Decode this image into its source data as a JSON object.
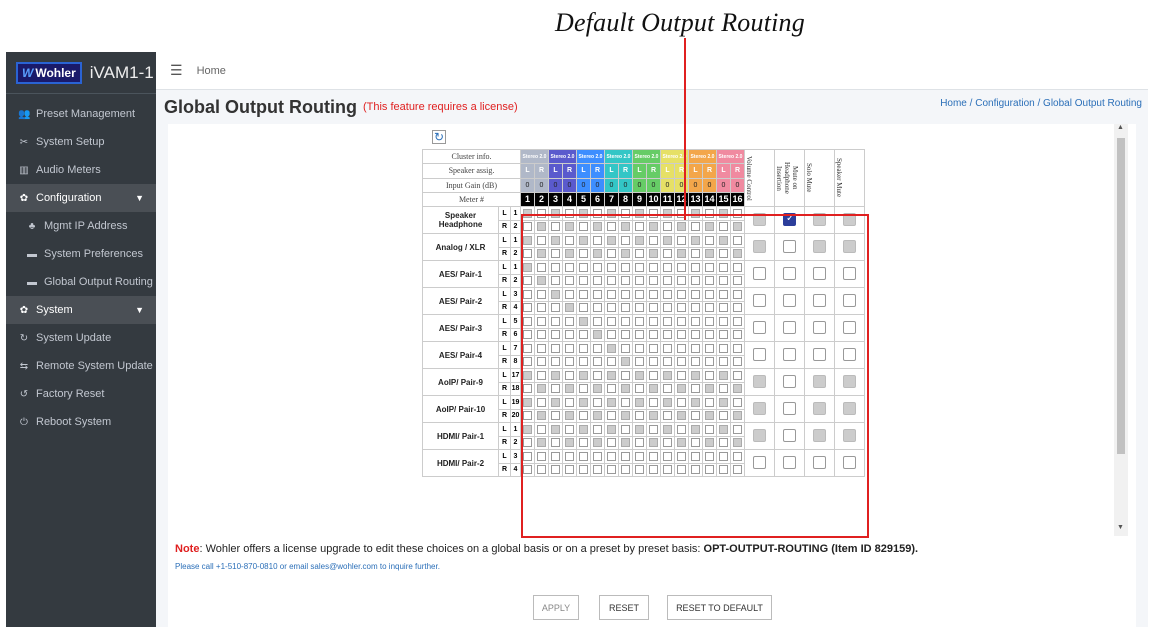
{
  "annotation": {
    "title": "Default Output Routing"
  },
  "sidebar": {
    "logo": "Wohler",
    "app_name": "iVAM1-1",
    "items": [
      {
        "label": "Preset Management",
        "icon": "users-icon"
      },
      {
        "label": "System Setup",
        "icon": "tools-icon"
      },
      {
        "label": "Audio Meters",
        "icon": "chart-icon"
      },
      {
        "label": "Configuration",
        "icon": "gear-icon"
      },
      {
        "label": "Mgmt IP Address",
        "icon": "network-icon"
      },
      {
        "label": "System Preferences",
        "icon": "card-icon"
      },
      {
        "label": "Global Output Routing",
        "icon": "card-icon"
      },
      {
        "label": "System",
        "icon": "gears-icon"
      },
      {
        "label": "System Update",
        "icon": "refresh-icon"
      },
      {
        "label": "Remote System Update",
        "icon": "remote-icon"
      },
      {
        "label": "Factory Reset",
        "icon": "undo-icon"
      },
      {
        "label": "Reboot System",
        "icon": "power-icon"
      }
    ]
  },
  "topbar": {
    "home": "Home"
  },
  "header": {
    "title": "Global Output Routing",
    "license": "(This feature requires a license)"
  },
  "breadcrumb": {
    "home": "Home",
    "sep": "/",
    "config": "Configuration",
    "current": "Global Output Routing"
  },
  "grid": {
    "cluster_label": "Cluster info.",
    "speaker_label": "Speaker assig.",
    "gain_label": "Input Gain (dB)",
    "meter_label": "Meter #",
    "cluster": "Stereo 2.0",
    "l": "L",
    "r": "R",
    "gain": "0",
    "meters": [
      "1",
      "2",
      "3",
      "4",
      "5",
      "6",
      "7",
      "8",
      "9",
      "10",
      "11",
      "12",
      "13",
      "14",
      "15",
      "16"
    ],
    "extra_heads": [
      "Volume Control",
      "Mute on Headphone Insertion",
      "Solo Mute",
      "Speaker Mute"
    ],
    "rows": [
      {
        "name": "Speaker Headphone",
        "l": "1",
        "r": "2"
      },
      {
        "name": "Analog / XLR",
        "l": "1",
        "r": "2"
      },
      {
        "name": "AES/ Pair-1",
        "l": "1",
        "r": "2"
      },
      {
        "name": "AES/ Pair-2",
        "l": "3",
        "r": "4"
      },
      {
        "name": "AES/ Pair-3",
        "l": "5",
        "r": "6"
      },
      {
        "name": "AES/ Pair-4",
        "l": "7",
        "r": "8"
      },
      {
        "name": "AoIP/ Pair-9",
        "l": "17",
        "r": "18"
      },
      {
        "name": "AoIP/ Pair-10",
        "l": "19",
        "r": "20"
      },
      {
        "name": "HDMI/ Pair-1",
        "l": "1",
        "r": "2"
      },
      {
        "name": "HDMI/ Pair-2",
        "l": "3",
        "r": "4"
      }
    ]
  },
  "note": {
    "label": "Note",
    "text": ": Wohler offers a license upgrade to edit these choices on a global basis or on a preset by preset basis: ",
    "bold": "OPT-OUTPUT-ROUTING (Item ID 829159).",
    "call": "Please call +1-510-870-0810 or email sales@wohler.com to inquire further."
  },
  "buttons": {
    "apply": "APPLY",
    "reset": "RESET",
    "reset_default": "RESET TO DEFAULT"
  }
}
